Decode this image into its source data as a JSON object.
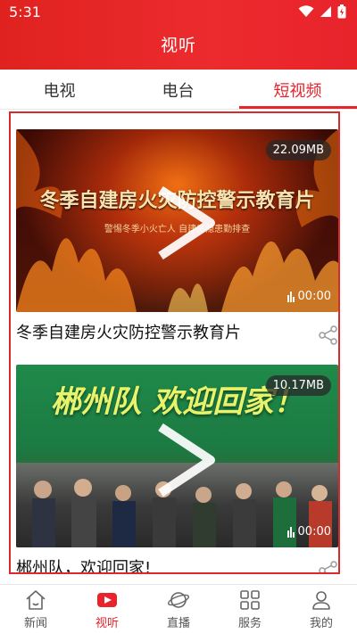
{
  "status_bar": {
    "time": "5:31"
  },
  "header": {
    "title": "视听"
  },
  "tabs": [
    {
      "label": "电视",
      "active": false
    },
    {
      "label": "电台",
      "active": false
    },
    {
      "label": "短视频",
      "active": true
    }
  ],
  "videos": [
    {
      "title": "冬季自建房火灾防控警示教育片",
      "size": "22.09MB",
      "duration": "00:00",
      "thumbnail_text": "冬季自建房火灾防控警示教育片",
      "thumbnail_subtext": "警惕冬季小火亡人 自建房隐患勤排查"
    },
    {
      "title": "郴州队，欢迎回家!",
      "size": "10.17MB",
      "duration": "00:00",
      "thumbnail_text": "郴州队 欢迎回家！"
    }
  ],
  "bottom_nav": [
    {
      "label": "新闻",
      "icon": "home-icon",
      "active": false
    },
    {
      "label": "视听",
      "icon": "video-play-icon",
      "active": true
    },
    {
      "label": "直播",
      "icon": "planet-icon",
      "active": false
    },
    {
      "label": "服务",
      "icon": "grid-icon",
      "active": false
    },
    {
      "label": "我的",
      "icon": "user-icon",
      "active": false
    }
  ],
  "colors": {
    "brand": "#e8232b",
    "frame_outline": "#d92b2b"
  }
}
